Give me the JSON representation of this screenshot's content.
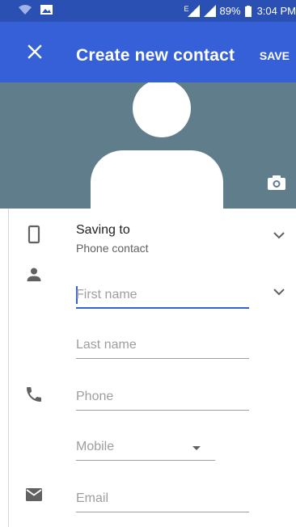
{
  "status_bar": {
    "battery": "89%",
    "time": "3:04 PM",
    "signal_label": "E"
  },
  "app_bar": {
    "title": "Create new contact",
    "save_label": "SAVE"
  },
  "account": {
    "title": "Saving to",
    "subtitle": "Phone contact"
  },
  "fields": {
    "first_name_placeholder": "First name",
    "last_name_placeholder": "Last name",
    "phone_placeholder": "Phone",
    "phone_type": "Mobile",
    "email_placeholder": "Email"
  },
  "colors": {
    "status_bar": "#2a50b4",
    "app_bar": "#3560d8",
    "photo_background": "#607d8b",
    "icon": "#616161"
  },
  "icons": [
    "wifi-icon",
    "image-icon",
    "signal-icon",
    "battery-icon",
    "close-icon",
    "camera-icon",
    "phone-device-icon",
    "person-icon",
    "call-icon",
    "mail-icon",
    "chevron-down-icon"
  ]
}
